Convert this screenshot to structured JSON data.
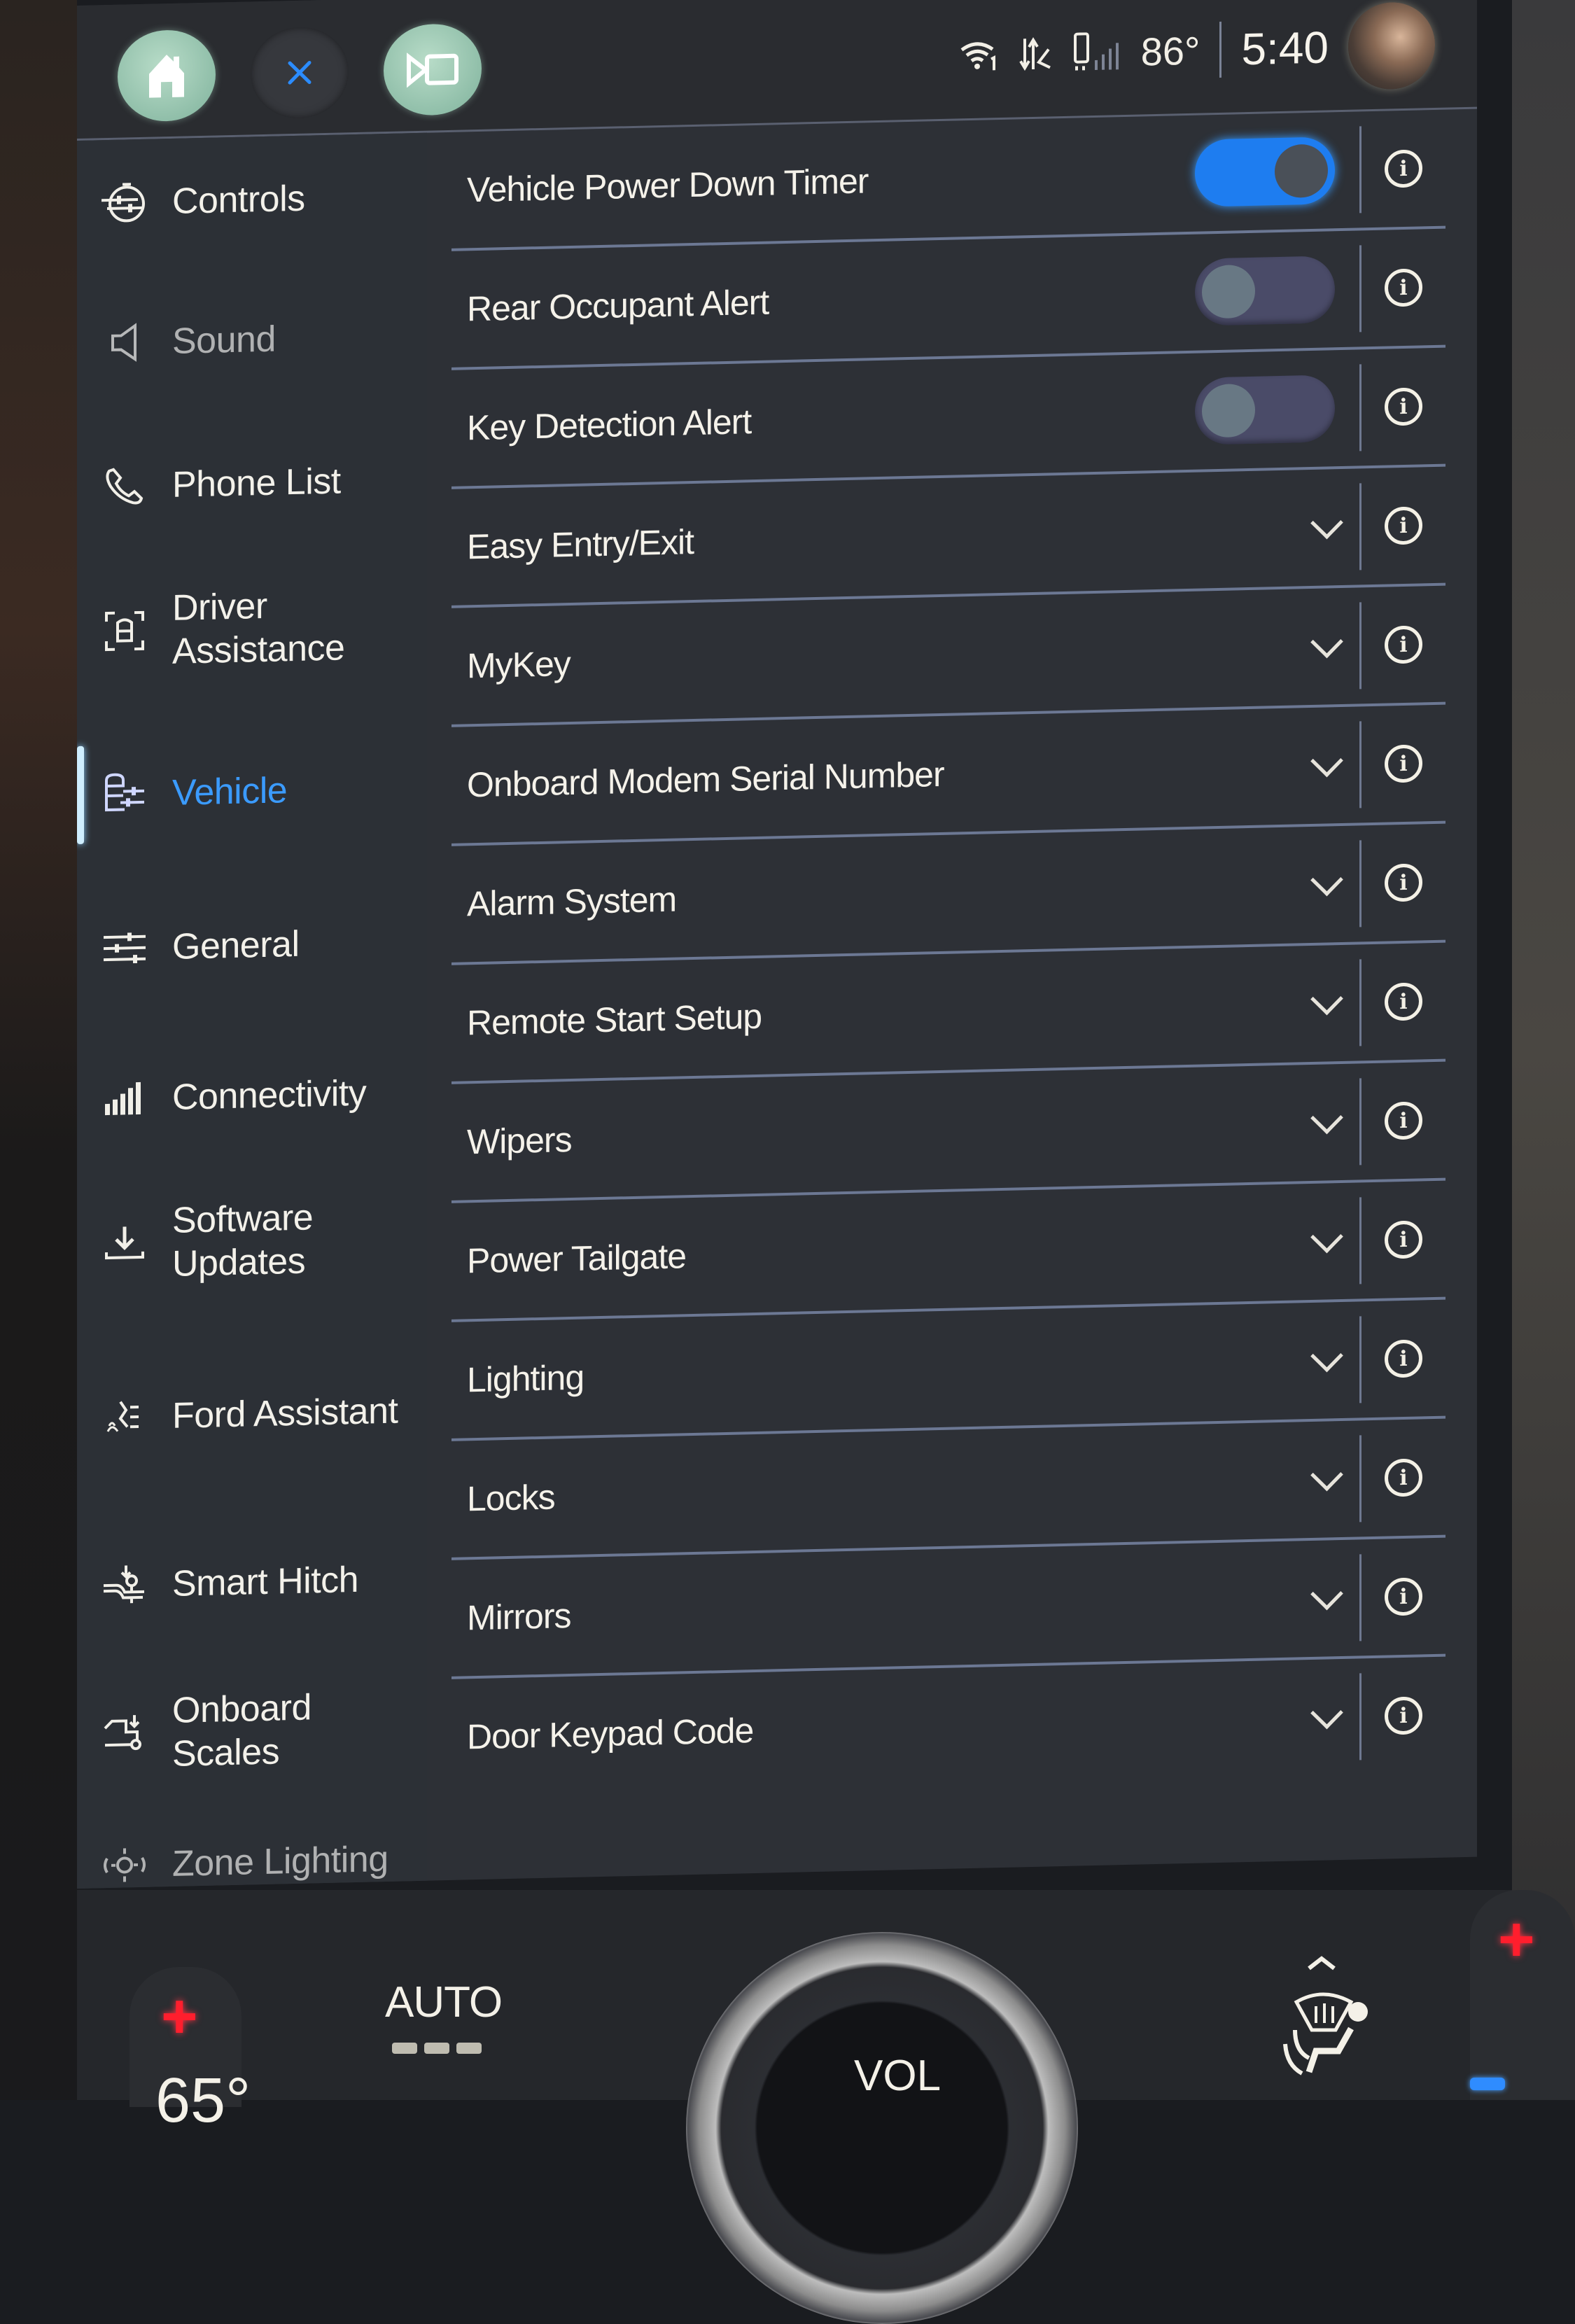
{
  "header": {
    "buttons": [
      {
        "name": "home-button",
        "icon": "home-icon"
      },
      {
        "name": "close-button",
        "icon": "close-icon"
      },
      {
        "name": "camera-button",
        "icon": "camera-icon"
      }
    ],
    "status": {
      "wifi": "wifi-icon",
      "data": "data-transfer-icon",
      "phone_signal": "phone-signal-icon",
      "temperature": "86°",
      "time": "5:40",
      "avatar": "profile-avatar"
    }
  },
  "sidebar": {
    "items": [
      {
        "label": "Controls",
        "icon": "controls-icon",
        "state": "normal"
      },
      {
        "label": "Sound",
        "icon": "speaker-icon",
        "state": "dim"
      },
      {
        "label": "Phone List",
        "icon": "phone-icon",
        "state": "normal"
      },
      {
        "label": "Driver Assistance",
        "icon": "driver-assist-icon",
        "state": "normal"
      },
      {
        "label": "Vehicle",
        "icon": "vehicle-settings-icon",
        "state": "active"
      },
      {
        "label": "General",
        "icon": "sliders-icon",
        "state": "normal"
      },
      {
        "label": "Connectivity",
        "icon": "signal-bars-icon",
        "state": "normal"
      },
      {
        "label": "Software Updates",
        "icon": "download-icon",
        "state": "normal"
      },
      {
        "label": "Ford Assistant",
        "icon": "voice-assistant-icon",
        "state": "normal"
      },
      {
        "label": "Smart Hitch",
        "icon": "hitch-icon",
        "state": "normal"
      },
      {
        "label": "Onboard Scales",
        "icon": "scales-icon",
        "state": "normal"
      },
      {
        "label": "Zone Lighting",
        "icon": "zone-lighting-icon",
        "state": "dim"
      }
    ]
  },
  "settings": {
    "rows": [
      {
        "label": "Vehicle Power Down Timer",
        "control": "toggle",
        "value": true
      },
      {
        "label": "Rear Occupant Alert",
        "control": "toggle",
        "value": false
      },
      {
        "label": "Key Detection Alert",
        "control": "toggle",
        "value": false
      },
      {
        "label": "Easy Entry/Exit",
        "control": "expand"
      },
      {
        "label": "MyKey",
        "control": "expand"
      },
      {
        "label": "Onboard Modem Serial Number",
        "control": "expand"
      },
      {
        "label": "Alarm System",
        "control": "expand"
      },
      {
        "label": "Remote Start Setup",
        "control": "expand"
      },
      {
        "label": "Wipers",
        "control": "expand"
      },
      {
        "label": "Power Tailgate",
        "control": "expand"
      },
      {
        "label": "Lighting",
        "control": "expand"
      },
      {
        "label": "Locks",
        "control": "expand"
      },
      {
        "label": "Mirrors",
        "control": "expand"
      },
      {
        "label": "Door Keypad Code",
        "control": "expand"
      }
    ]
  },
  "climate": {
    "driver_temp": "65°",
    "mode": "AUTO",
    "fan_level": "---",
    "volume_label": "VOL",
    "defrost_icon": "defrost-airflow-icon",
    "plus_symbol": "+",
    "accent_red": "#ff1e2d",
    "accent_blue": "#2f8cff"
  },
  "colors": {
    "active_accent": "#3b9bff",
    "toggle_on": "#1e7df0",
    "toggle_off": "#4a4b68",
    "divider": "#6c7894"
  }
}
